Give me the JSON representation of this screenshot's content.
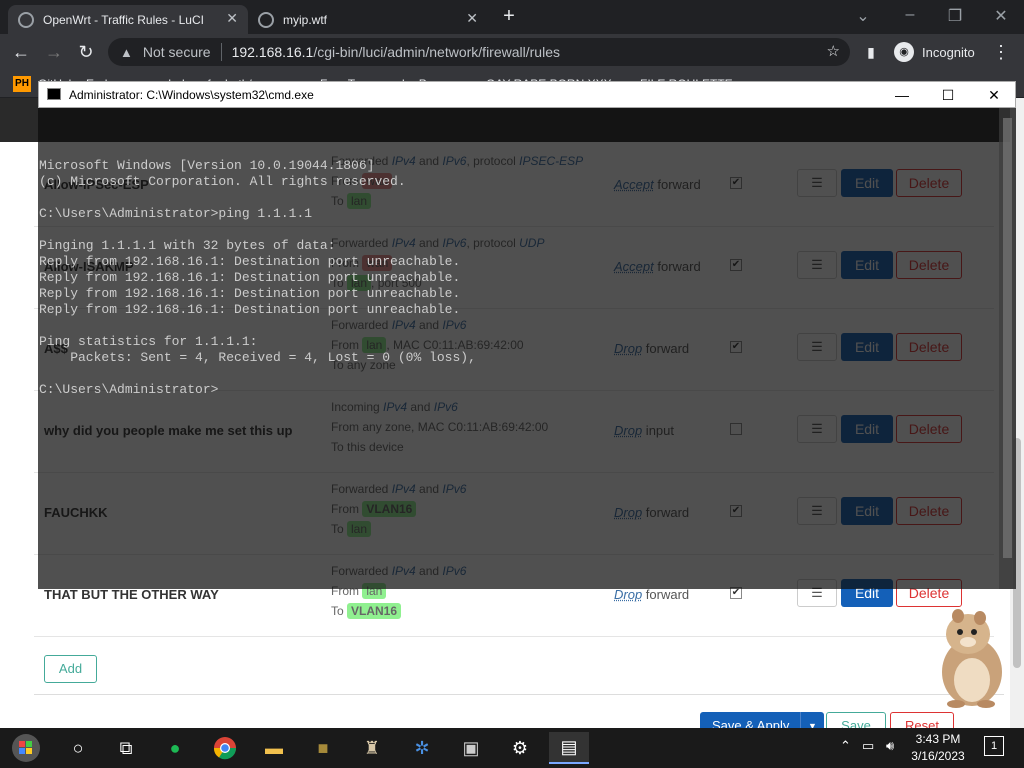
{
  "browser": {
    "tabs": [
      {
        "title": "OpenWrt - Traffic Rules - LuCI",
        "active": true
      },
      {
        "title": "myip.wtf",
        "active": false
      }
    ],
    "url_prefix": "Not secure",
    "url_host": "192.168.16.1",
    "url_path": "/cgi-bin/luci/admin/network/firewall/rules",
    "profile_label": "Incognito",
    "bookmarks": [
      "PH",
      "GitHub - Enderman...",
      "Index of ~darth/pos...",
      "Free Transgender P...",
      "GAY RAPE PORN XXX",
      "FILE ROULETTE"
    ]
  },
  "cmd": {
    "title": "Administrator: C:\\Windows\\system32\\cmd.exe",
    "lines": [
      "Microsoft Windows [Version 10.0.19044.1806]",
      "(c) Microsoft Corporation. All rights reserved.",
      "",
      "C:\\Users\\Administrator>ping 1.1.1.1",
      "",
      "Pinging 1.1.1.1 with 32 bytes of data:",
      "Reply from 192.168.16.1: Destination port unreachable.",
      "Reply from 192.168.16.1: Destination port unreachable.",
      "Reply from 192.168.16.1: Destination port unreachable.",
      "Reply from 192.168.16.1: Destination port unreachable.",
      "",
      "Ping statistics for 1.1.1.1:",
      "    Packets: Sent = 4, Received = 4, Lost = 0 (0% loss),",
      "",
      "C:\\Users\\Administrator>"
    ]
  },
  "rules": [
    {
      "name": "Allow-IPSec-ESP",
      "line1_pre": "Forwarded ",
      "line1_a": "IPv4",
      "line1_mid": " and ",
      "line1_b": "IPv6",
      "line1_post": ", protocol ",
      "line1_c": "IPSEC-ESP",
      "from_label": "From ",
      "from_zone": "wan",
      "from_extra": "",
      "to_label": "To ",
      "to_zone": "lan",
      "to_extra": "",
      "action": "Accept",
      "dir": " forward",
      "enabled": "✔"
    },
    {
      "name": "Allow-ISAKMP",
      "line1_pre": "Forwarded ",
      "line1_a": "IPv4",
      "line1_mid": " and ",
      "line1_b": "IPv6",
      "line1_post": ", protocol ",
      "line1_c": "UDP",
      "from_label": "From ",
      "from_zone": "wan",
      "from_extra": "",
      "to_label": "To ",
      "to_zone": "lan",
      "to_extra": ", port 500",
      "action": "Accept",
      "dir": " forward",
      "enabled": "✔"
    },
    {
      "name": "A$$",
      "line1_pre": "Forwarded ",
      "line1_a": "IPv4",
      "line1_mid": " and ",
      "line1_b": "IPv6",
      "line1_post": "",
      "line1_c": "",
      "from_label": "From ",
      "from_zone": "lan",
      "from_extra": ", MAC C0:11:AB:69:42:00",
      "to_label": "To ",
      "to_zone": "any zone",
      "to_extra": "",
      "action": "Drop",
      "dir": " forward",
      "enabled": "✔"
    },
    {
      "name": "why did you people make me set this up",
      "line1_pre": "Incoming ",
      "line1_a": "IPv4",
      "line1_mid": " and ",
      "line1_b": "IPv6",
      "line1_post": "",
      "line1_c": "",
      "from_label": "From ",
      "from_zone": "any zone",
      "from_extra": ", MAC C0:11:AB:69:42:00",
      "to_label": "To ",
      "to_zone": "this device",
      "to_extra": "",
      "action": "Drop",
      "dir": " input",
      "enabled": ""
    },
    {
      "name": "FAUCHKK",
      "line1_pre": "Forwarded ",
      "line1_a": "IPv4",
      "line1_mid": " and ",
      "line1_b": "IPv6",
      "line1_post": "",
      "line1_c": "",
      "from_label": "From ",
      "from_zone": "VLAN16",
      "from_extra": "",
      "to_label": "To ",
      "to_zone": "lan",
      "to_extra": "",
      "action": "Drop",
      "dir": " forward",
      "enabled": "✔"
    },
    {
      "name": "THAT BUT THE OTHER WAY",
      "line1_pre": "Forwarded ",
      "line1_a": "IPv4",
      "line1_mid": " and ",
      "line1_b": "IPv6",
      "line1_post": "",
      "line1_c": "",
      "from_label": "From ",
      "from_zone": "lan",
      "from_extra": "",
      "to_label": "To ",
      "to_zone": "VLAN16",
      "to_extra": "",
      "action": "Drop",
      "dir": " forward",
      "enabled": "✔"
    }
  ],
  "buttons": {
    "menu": "☰",
    "edit": "Edit",
    "delete": "Delete",
    "add": "Add",
    "save_apply": "Save & Apply",
    "save": "Save",
    "reset": "Reset"
  },
  "taskbar": {
    "time": "3:43 PM",
    "date": "3/16/2023",
    "notifications": "1"
  }
}
